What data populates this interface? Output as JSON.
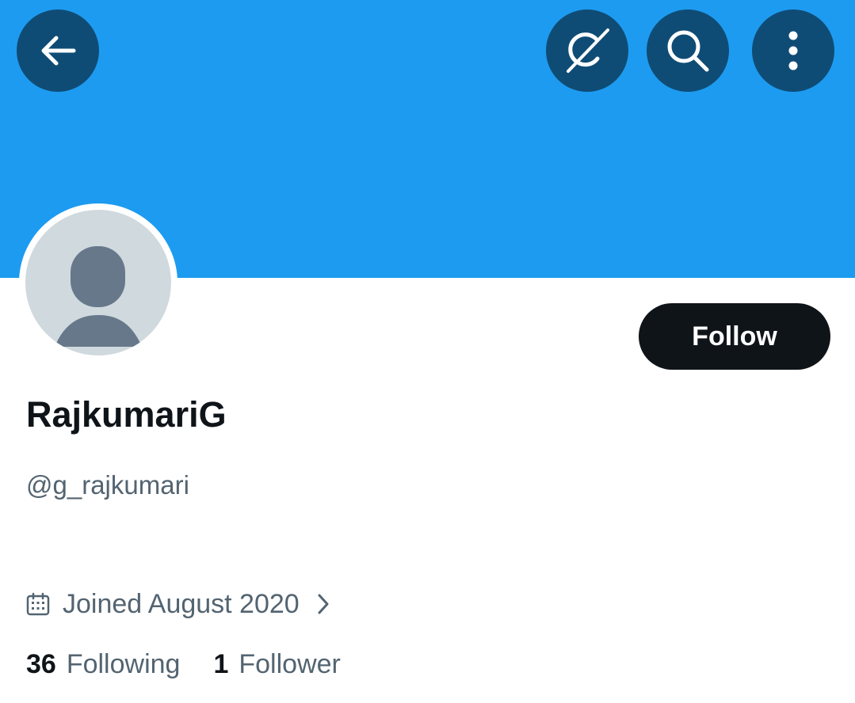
{
  "header": {
    "back_icon": "arrow-left-icon",
    "grok_icon": "grok-icon",
    "search_icon": "search-icon",
    "more_icon": "more-vertical-icon",
    "banner_color": "#1d9bf0",
    "button_color": "#0f4c75"
  },
  "profile": {
    "display_name": "RajkumariG",
    "handle": "@g_rajkumari",
    "follow_label": "Follow",
    "joined_text": "Joined August 2020",
    "following_count": "36",
    "following_label": "Following",
    "followers_count": "1",
    "followers_label": "Follower"
  }
}
